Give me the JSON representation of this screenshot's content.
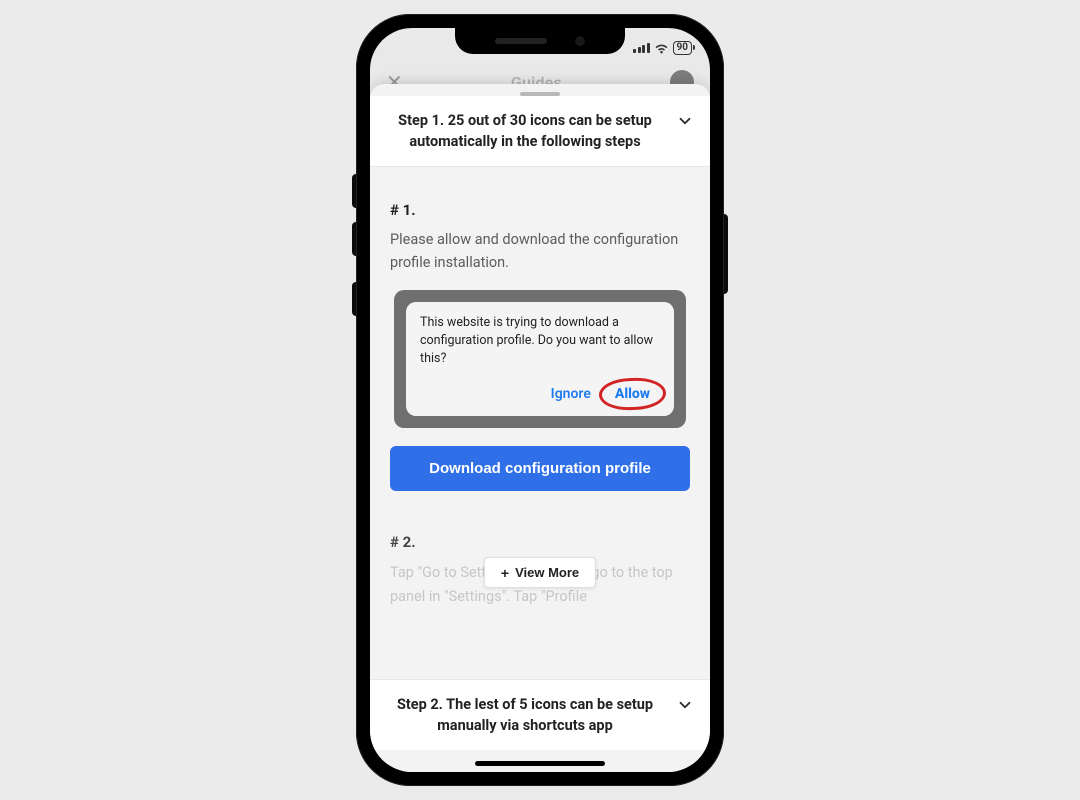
{
  "status": {
    "battery": "90"
  },
  "nav": {
    "close": "✕",
    "title": "Guides"
  },
  "step1": {
    "title": "Step 1. 25 out of 30 icons can be setup automatically in the following steps"
  },
  "s1": {
    "num": "# 1.",
    "desc": "Please allow and download the configuration profile installation.",
    "dialog_msg": "This website is trying to download a configuration profile. Do you want to allow this?",
    "ignore": "Ignore",
    "allow": "Allow",
    "cta": "Download configuration profile"
  },
  "s2": {
    "num": "# 2.",
    "faded": "Tap \"Go to Settings\" below and go to the top panel in \"Settings\". Tap \"Profile",
    "view_more": "View More"
  },
  "step2": {
    "title": "Step 2. The lest of 5 icons can be setup manually via shortcuts app"
  }
}
